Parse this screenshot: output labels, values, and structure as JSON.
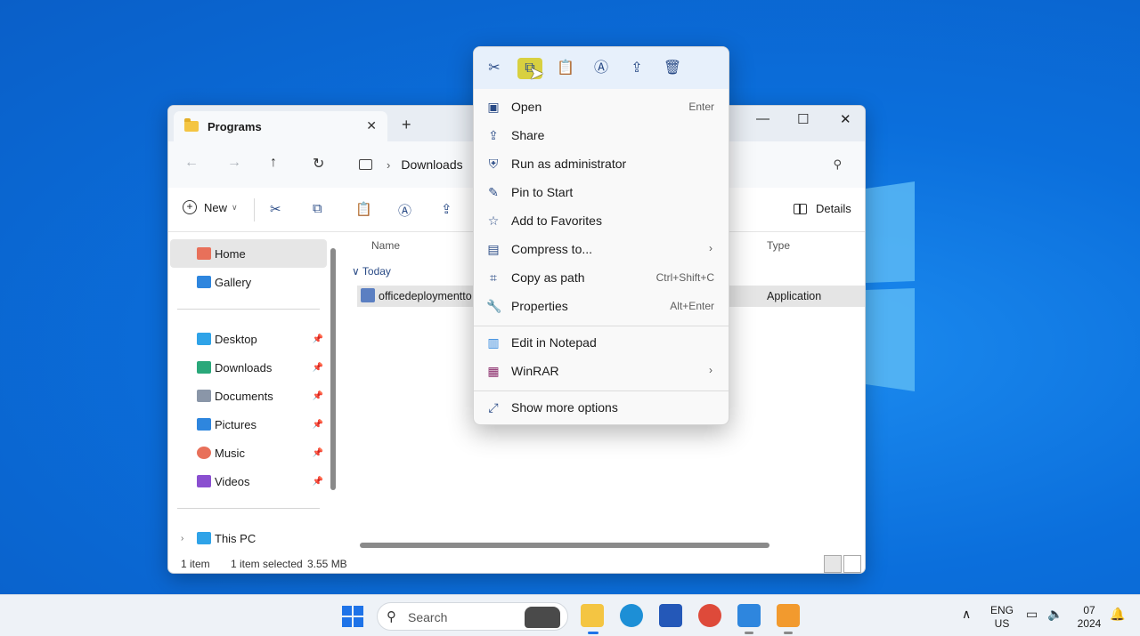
{
  "explorer": {
    "tab_title": "Programs",
    "new_tab": "+",
    "path_location": "Downloads",
    "window": {
      "minimize": "—",
      "maximize": "☐",
      "close": "✕"
    },
    "command_bar": {
      "new_label": "New",
      "details_label": "Details"
    },
    "sidebar": {
      "home": "Home",
      "gallery": "Gallery",
      "pinned": [
        {
          "label": "Desktop",
          "color": "#2fa3e8"
        },
        {
          "label": "Downloads",
          "color": "#2aa87a"
        },
        {
          "label": "Documents",
          "color": "#8a96a8"
        },
        {
          "label": "Pictures",
          "color": "#2e86de"
        },
        {
          "label": "Music",
          "color": "#e8705a"
        },
        {
          "label": "Videos",
          "color": "#8a4fd0"
        }
      ],
      "this_pc": "This PC"
    },
    "columns": {
      "name": "Name",
      "type": "Type"
    },
    "group_label": "Today",
    "file": {
      "name": "officedeploymentto",
      "type": "Application"
    },
    "status": {
      "count": "1 item",
      "selected": "1 item selected",
      "size": "3.55 MB"
    }
  },
  "context_menu": {
    "actions": [
      "cut-icon",
      "copy-icon",
      "paste-icon",
      "rename-icon",
      "share-icon",
      "delete-icon"
    ],
    "items": [
      {
        "label": "Open",
        "shortcut": "Enter",
        "icon": "open-icon"
      },
      {
        "label": "Share",
        "shortcut": "",
        "icon": "share-icon"
      },
      {
        "label": "Run as administrator",
        "shortcut": "",
        "icon": "shield-icon"
      },
      {
        "label": "Pin to Start",
        "shortcut": "",
        "icon": "pin-icon"
      },
      {
        "label": "Add to Favorites",
        "shortcut": "",
        "icon": "star-icon"
      },
      {
        "label": "Compress to...",
        "shortcut": "",
        "icon": "zip-icon",
        "submenu": true
      },
      {
        "label": "Copy as path",
        "shortcut": "Ctrl+Shift+C",
        "icon": "path-icon"
      },
      {
        "label": "Properties",
        "shortcut": "Alt+Enter",
        "icon": "wrench-icon"
      }
    ],
    "extra_items": [
      {
        "label": "Edit in Notepad",
        "icon": "notepad-icon"
      },
      {
        "label": "WinRAR",
        "icon": "winrar-icon",
        "submenu": true
      }
    ],
    "more_options": "Show more options"
  },
  "taskbar": {
    "search_placeholder": "Search",
    "language_top": "ENG",
    "language_bottom": "US",
    "clock_top": "07",
    "clock_bottom": "2024"
  }
}
